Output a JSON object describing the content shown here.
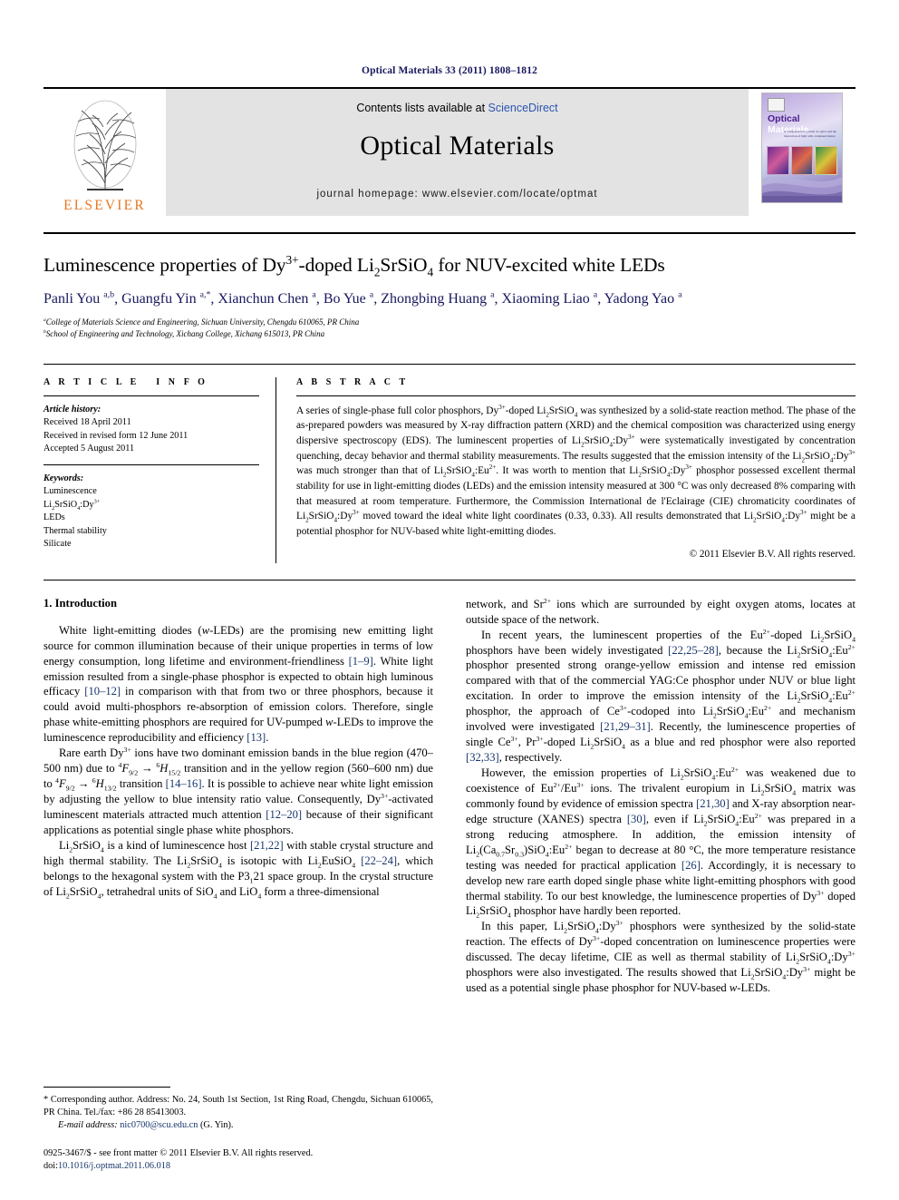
{
  "running_head": "Optical Materials 33 (2011) 1808–1812",
  "masthead": {
    "publisher": "ELSEVIER",
    "contents_prefix": "Contents lists available at ",
    "contents_link": "ScienceDirect",
    "journal_title": "Optical Materials",
    "journal_homepage": "journal homepage: www.elsevier.com/locate/optmat",
    "cover_title_1": "Optical",
    "cover_title_2": "Materials",
    "cover_subtitle": "A comprehensive journal on optics and the interaction of light with condensed matter"
  },
  "article": {
    "title_part1": "Luminescence properties of Dy",
    "title_sup1": "3+",
    "title_part2": "-doped Li",
    "title_sub1": "2",
    "title_part3": "SrSiO",
    "title_sub2": "4",
    "title_part4": " for NUV-excited white LEDs",
    "authors": "Panli You a,b, Guangfu Yin a,*, Xianchun Chen a, Bo Yue a, Zhongbing Huang a, Xiaoming Liao a, Yadong Yao a",
    "affiliation_a": "College of Materials Science and Engineering, Sichuan University, Chengdu 610065, PR China",
    "affiliation_b": "School of Engineering and Technology, Xichang College, Xichang 615013, PR China"
  },
  "info": {
    "heading": "ARTICLE INFO",
    "history_label": "Article history:",
    "history": [
      "Received 18 April 2011",
      "Received in revised form 12 June 2011",
      "Accepted 5 August 2011"
    ],
    "keywords_label": "Keywords:",
    "keywords": [
      "Luminescence",
      "Li2SrSiO4:Dy3+",
      "LEDs",
      "Thermal stability",
      "Silicate"
    ]
  },
  "abstract": {
    "heading": "ABSTRACT",
    "text": "A series of single-phase full color phosphors, Dy3+-doped Li2SrSiO4 was synthesized by a solid-state reaction method. The phase of the as-prepared powders was measured by X-ray diffraction pattern (XRD) and the chemical composition was characterized using energy dispersive spectroscopy (EDS). The luminescent properties of Li2SrSiO4:Dy3+ were systematically investigated by concentration quenching, decay behavior and thermal stability measurements. The results suggested that the emission intensity of the Li2SrSiO4:Dy3+ was much stronger than that of Li2SrSiO4:Eu2+. It was worth to mention that Li2SrSiO4:Dy3+ phosphor possessed excellent thermal stability for use in light-emitting diodes (LEDs) and the emission intensity measured at 300 °C was only decreased 8% comparing with that measured at room temperature. Furthermore, the Commission International de l'Eclairage (CIE) chromaticity coordinates of Li2SrSiO4:Dy3+ moved toward the ideal white light coordinates (0.33, 0.33). All results demonstrated that Li2SrSiO4:Dy3+ might be a potential phosphor for NUV-based white light-emitting diodes.",
    "copyright": "© 2011 Elsevier B.V. All rights reserved."
  },
  "body": {
    "section_heading": "1. Introduction",
    "left_paragraphs": [
      "White light-emitting diodes (w-LEDs) are the promising new emitting light source for common illumination because of their unique properties in terms of low energy consumption, long lifetime and environment-friendliness [1–9]. White light emission resulted from a single-phase phosphor is expected to obtain high luminous efficacy [10–12] in comparison with that from two or three phosphors, because it could avoid multi-phosphors re-absorption of emission colors. Therefore, single phase white-emitting phosphors are required for UV-pumped w-LEDs to improve the luminescence reproducibility and efficiency [13].",
      "Rare earth Dy3+ ions have two dominant emission bands in the blue region (470–500 nm) due to 4F9/2 → 6H15/2 transition and in the yellow region (560–600 nm) due to 4F9/2 → 6H13/2 transition [14–16]. It is possible to achieve near white light emission by adjusting the yellow to blue intensity ratio value. Consequently, Dy3+-activated luminescent materials attracted much attention [12–20] because of their significant applications as potential single phase white phosphors.",
      "Li2SrSiO4 is a kind of luminescence host [21,22] with stable crystal structure and high thermal stability. The Li2SrSiO4 is isotopic with Li2EuSiO4 [22–24], which belongs to the hexagonal system with the P3121 space group. In the crystal structure of Li2SrSiO4, tetrahedral units of SiO4 and LiO4 form a three-dimensional"
    ],
    "right_paragraphs": [
      "network, and Sr2+ ions which are surrounded by eight oxygen atoms, locates at outside space of the network.",
      "In recent years, the luminescent properties of the Eu2+-doped Li2SrSiO4 phosphors have been widely investigated [22,25–28], because the Li2SrSiO4:Eu2+ phosphor presented strong orange-yellow emission and intense red emission compared with that of the commercial YAG:Ce phosphor under NUV or blue light excitation. In order to improve the emission intensity of the Li2SrSiO4:Eu2+ phosphor, the approach of Ce3+-codoped into Li2SrSiO4:Eu2+ and mechanism involved were investigated [21,29–31]. Recently, the luminescence properties of single Ce3+, Pr3+-doped Li2SrSiO4 as a blue and red phosphor were also reported [32,33], respectively.",
      "However, the emission properties of Li2SrSiO4:Eu2+ was weakened due to coexistence of Eu2+/Eu3+ ions. The trivalent europium in Li2SrSiO4 matrix was commonly found by evidence of emission spectra [21,30] and X-ray absorption near-edge structure (XANES) spectra [30], even if Li2SrSiO4:Eu2+ was prepared in a strong reducing atmosphere. In addition, the emission intensity of Li2(Ca0.7Sr0.3)SiO4:Eu2+ began to decrease at 80 °C, the more temperature resistance testing was needed for practical application [26]. Accordingly, it is necessary to develop new rare earth doped single phase white light-emitting phosphors with good thermal stability. To our best knowledge, the luminescence properties of Dy3+ doped Li2SrSiO4 phosphor have hardly been reported.",
      "In this paper, Li2SrSiO4:Dy3+ phosphors were synthesized by the solid-state reaction. The effects of Dy3+-doped concentration on luminescence properties were discussed. The decay lifetime, CIE as well as thermal stability of Li2SrSiO4:Dy3+ phosphors were also investigated. The results showed that Li2SrSiO4:Dy3+ might be used as a potential single phase phosphor for NUV-based w-LEDs."
    ]
  },
  "footer": {
    "corresponding": "* Corresponding author. Address: No. 24, South 1st Section, 1st Ring Road, Chengdu, Sichuan 610065, PR China. Tel./fax: +86 28 85413003.",
    "email_label": "E-mail address:",
    "email": "nic0700@scu.edu.cn",
    "email_person": "(G. Yin).",
    "issn_line": "0925-3467/$ - see front matter © 2011 Elsevier B.V. All rights reserved.",
    "doi_label": "doi:",
    "doi": "10.1016/j.optmat.2011.06.018"
  }
}
